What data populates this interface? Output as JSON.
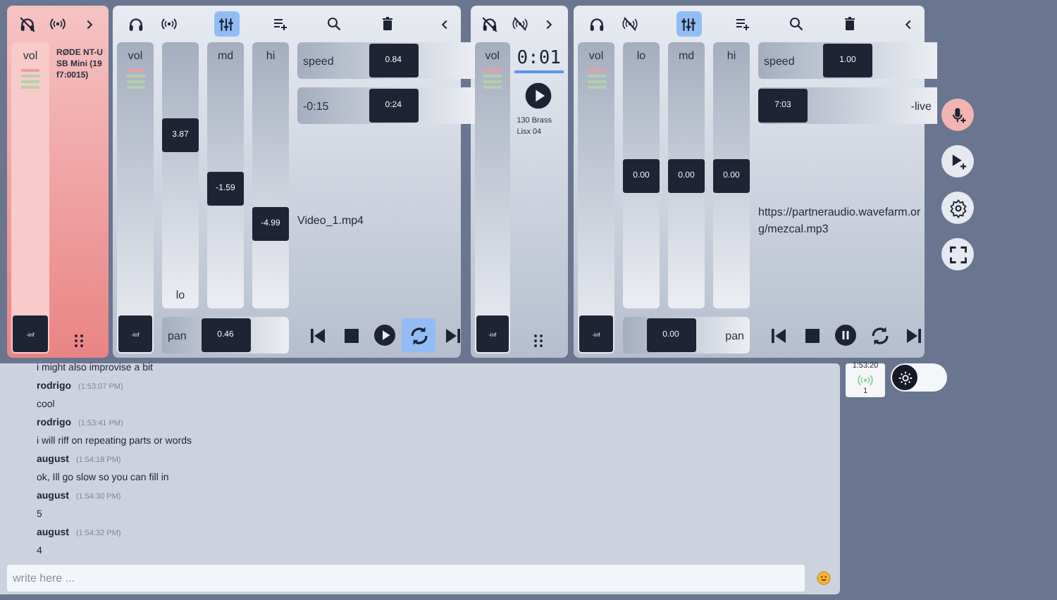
{
  "strips": [
    {
      "kind": "input",
      "live": true,
      "monitor": false,
      "broadcast": true,
      "volume": {
        "label": "vol",
        "level": 0,
        "reading": "-inf"
      },
      "device": "RØDE NT-USB Mini (19f7:0015)"
    },
    {
      "kind": "player",
      "monitor": true,
      "broadcast": true,
      "eq_open": true,
      "volume": {
        "label": "vol",
        "level": 0,
        "reading": "-inf"
      },
      "eq": [
        {
          "label": "lo",
          "label_bottom": true,
          "level": 0.67,
          "reading": "3.87"
        },
        {
          "label": "md",
          "label_bottom": false,
          "level": 0.44,
          "reading": "-1.59"
        },
        {
          "label": "hi",
          "label_bottom": false,
          "level": 0.29,
          "reading": "-4.99"
        }
      ],
      "speed": {
        "label": "speed",
        "label_end": false,
        "level": 0.55,
        "reading": "0.84"
      },
      "position": {
        "label": "-0:15",
        "label_end": false,
        "level": 0.55,
        "reading": "0:24"
      },
      "file": "Video_1.mp4",
      "pan": {
        "label": "pan",
        "label_end": false,
        "level": 0.5,
        "reading": "0.46"
      },
      "playing": false,
      "loop": true
    },
    {
      "kind": "mini",
      "live": false,
      "monitor": false,
      "broadcast": false,
      "volume": {
        "label": "vol",
        "level": 0,
        "reading": "-inf"
      },
      "time": "0:01",
      "playing": false,
      "track": "130 Brass Lisx 04"
    },
    {
      "kind": "player",
      "monitor": true,
      "broadcast": false,
      "eq_open": true,
      "volume": {
        "label": "vol",
        "level": 0,
        "reading": "-inf"
      },
      "eq": [
        {
          "label": "lo",
          "label_bottom": false,
          "level": 0.5,
          "reading": "0.00"
        },
        {
          "label": "md",
          "label_bottom": false,
          "level": 0.5,
          "reading": "0.00"
        },
        {
          "label": "hi",
          "label_bottom": false,
          "level": 0.5,
          "reading": "0.00"
        }
      ],
      "speed": {
        "label": "speed",
        "label_end": false,
        "level": 0.5,
        "reading": "1.00"
      },
      "position": {
        "label": "-live",
        "label_end": true,
        "level": 0,
        "reading": "7:03"
      },
      "file": "https://partneraudio.wavefarm.org/mezcal.mp3",
      "pan": {
        "label": "pan",
        "label_end": true,
        "level": 0.3,
        "reading": "0.00"
      },
      "playing": true,
      "loop": false
    }
  ],
  "chat": {
    "messages": [
      {
        "text": "i might also improvise a bit"
      },
      {
        "author": "rodrigo",
        "time": "(1:53:07 PM)",
        "text": "cool"
      },
      {
        "author": "rodrigo",
        "time": "(1:53:41 PM)",
        "text": "i will riff on repeating parts or words"
      },
      {
        "author": "august",
        "time": "(1:54:18 PM)",
        "text": "ok, Ill go slow so you can fill in"
      },
      {
        "author": "august",
        "time": "(1:54:30 PM)",
        "text": "5"
      },
      {
        "author": "august",
        "time": "(1:54:32 PM)",
        "text": "4"
      }
    ],
    "input": {
      "placeholder": "write here ..."
    }
  },
  "status": {
    "time": "1:53:20",
    "listeners": "1"
  },
  "theme_toggle": {
    "on": false
  }
}
